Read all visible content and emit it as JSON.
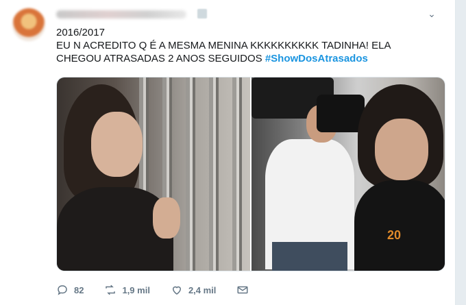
{
  "tweet": {
    "line1": "2016/2017",
    "line2": "EU N ACREDITO Q É A MESMA MENINA KKKKKKKKKK TADINHA! ELA",
    "line3_text": "CHEGOU ATRASADAS 2 ANOS SEGUIDOS",
    "hashtag": "#ShowDosAtrasados"
  },
  "media": {
    "right_print": "20"
  },
  "actions": {
    "replies": "82",
    "retweets": "1,9 mil",
    "likes": "2,4 mil"
  },
  "icons": {
    "reply": "reply-icon",
    "retweet": "retweet-icon",
    "like": "heart-icon",
    "dm": "envelope-icon",
    "menu": "chevron-down-icon"
  },
  "colors": {
    "hashtag": "#1b95e0",
    "action_gray": "#657786"
  }
}
